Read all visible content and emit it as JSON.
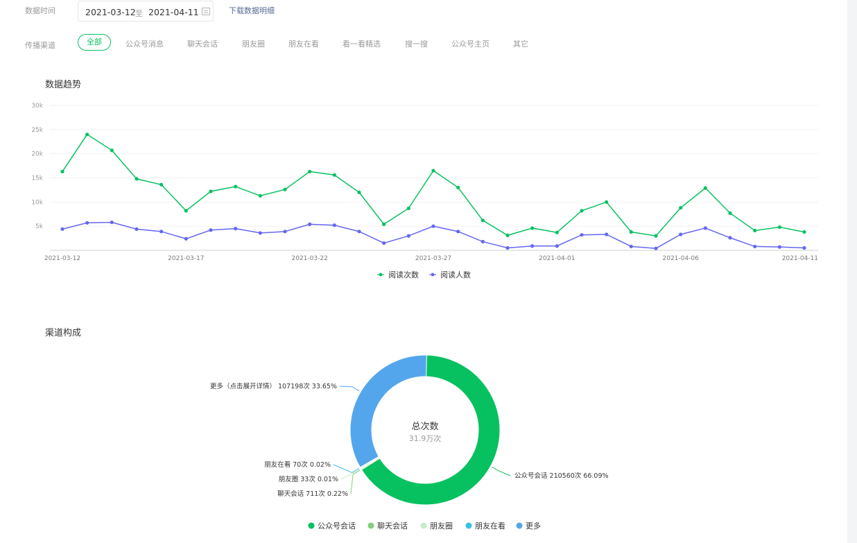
{
  "filters": {
    "date_label": "数据时间",
    "date_start": "2021-03-12",
    "date_sep": "至",
    "date_end": "2021-04-11",
    "download_link": "下载数据明细",
    "channel_label": "传播渠道",
    "channels": [
      "全部",
      "公众号消息",
      "聊天会话",
      "朋友圈",
      "朋友在看",
      "看一看精选",
      "搜一搜",
      "公众号主页",
      "其它"
    ],
    "active_channel": "全部"
  },
  "trend": {
    "title": "数据趋势",
    "chart_data": {
      "type": "line",
      "x_tick_labels": [
        "2021-03-12",
        "2021-03-17",
        "2021-03-22",
        "2021-03-27",
        "2021-04-01",
        "2021-04-06",
        "2021-04-11"
      ],
      "y_tick_labels": [
        "5k",
        "10k",
        "15k",
        "20k",
        "25k",
        "30k"
      ],
      "ylim": [
        0,
        30000
      ],
      "grid": true,
      "legend": "bottom-center",
      "x": [
        "2021-03-12",
        "2021-03-13",
        "2021-03-14",
        "2021-03-15",
        "2021-03-16",
        "2021-03-17",
        "2021-03-18",
        "2021-03-19",
        "2021-03-20",
        "2021-03-21",
        "2021-03-22",
        "2021-03-23",
        "2021-03-24",
        "2021-03-25",
        "2021-03-26",
        "2021-03-27",
        "2021-03-28",
        "2021-03-29",
        "2021-03-30",
        "2021-03-31",
        "2021-04-01",
        "2021-04-02",
        "2021-04-03",
        "2021-04-04",
        "2021-04-05",
        "2021-04-06",
        "2021-04-07",
        "2021-04-08",
        "2021-04-09",
        "2021-04-10",
        "2021-04-11"
      ],
      "series": [
        {
          "name": "阅读次数",
          "color": "#07c160",
          "values": [
            16300,
            24000,
            20700,
            14800,
            13600,
            8200,
            12200,
            13200,
            11300,
            12600,
            16300,
            15600,
            12000,
            5400,
            8700,
            16500,
            13000,
            6200,
            3100,
            4600,
            3700,
            8200,
            10000,
            3800,
            3000,
            8800,
            12900,
            7700,
            4100,
            4800,
            3800
          ]
        },
        {
          "name": "阅读人数",
          "color": "#6467f0",
          "values": [
            4400,
            5700,
            5800,
            4400,
            3900,
            2400,
            4200,
            4500,
            3600,
            3900,
            5400,
            5200,
            3900,
            1500,
            3000,
            5000,
            3900,
            1800,
            500,
            900,
            900,
            3200,
            3300,
            800,
            400,
            3300,
            4600,
            2600,
            800,
            700,
            500
          ]
        }
      ]
    }
  },
  "composition": {
    "title": "渠道构成",
    "center_title": "总次数",
    "center_value": "31.9万次",
    "chart_data": {
      "type": "pie",
      "donut": true,
      "slices": [
        {
          "name": "公众号会话",
          "value": 210560,
          "percent": 66.09,
          "label": "公众号会话 210560次 66.09%",
          "color": "#07c160"
        },
        {
          "name": "聊天会话",
          "value": 711,
          "percent": 0.22,
          "label": "聊天会话 711次 0.22%",
          "color": "#7fd17a"
        },
        {
          "name": "朋友圈",
          "value": 33,
          "percent": 0.01,
          "label": "朋友圈 33次 0.01%",
          "color": "#c8ecc9"
        },
        {
          "name": "朋友在看",
          "value": 70,
          "percent": 0.02,
          "label": "朋友在看 70次 0.02%",
          "color": "#39c0e3"
        },
        {
          "name": "更多",
          "value": 107198,
          "percent": 33.65,
          "label": "更多（点击展开详情） 107198次 33.65%",
          "color": "#54a6ec"
        }
      ]
    },
    "legend": [
      "公众号会话",
      "聊天会话",
      "朋友圈",
      "朋友在看",
      "更多"
    ]
  }
}
